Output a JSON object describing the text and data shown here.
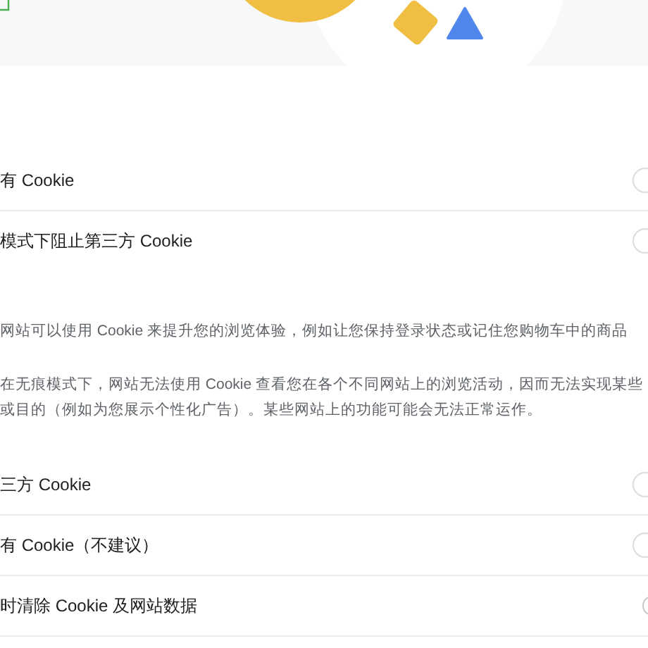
{
  "items": [
    {
      "kind": "radio",
      "label": "有 Cookie",
      "selected": false
    },
    {
      "kind": "radio",
      "label": "模式下阻止第三方 Cookie",
      "selected": false
    },
    {
      "kind": "paragraph",
      "lines": [
        "网站可以使用 Cookie 来提升您的浏览体验，例如让您保持登录状态或记住您购物车中的商品"
      ]
    },
    {
      "kind": "paragraph",
      "lines": [
        "在无痕模式下，网站无法使用 Cookie 查看您在各个不同网站上的浏览活动，因而无法实现某些",
        "或目的（例如为您展示个性化广告）。某些网站上的功能可能会无法正常运作。"
      ]
    },
    {
      "kind": "radio",
      "label": "三方 Cookie",
      "selected": false
    },
    {
      "kind": "radio",
      "label": "有 Cookie（不建议）",
      "selected": false
    },
    {
      "kind": "toggle",
      "label": "时清除 Cookie 及网站数据",
      "on": false
    }
  ]
}
